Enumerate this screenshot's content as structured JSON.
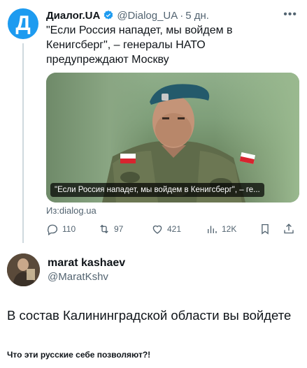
{
  "tweet1": {
    "avatar_letter": "Д",
    "author_name": "Диалог.UA",
    "handle": "@Dialog_UA",
    "separator": "·",
    "time": "5 дн.",
    "text": "\"Если Россия нападет, мы войдем в Кенигсберг\", – генералы НАТО предупреждают Москву",
    "card_caption": "\"Если Россия нападет, мы войдем в Кенигсберг\", – ге...",
    "from_label": "Из:dialog.ua",
    "actions": {
      "replies": "110",
      "reposts": "97",
      "likes": "421",
      "views": "12K"
    }
  },
  "tweet2": {
    "author_name": "marat kashaev",
    "handle": "@MaratKshv",
    "text": "В состав Калининградской области вы войдете"
  },
  "footer_caption": "Что эти русские себе позволяют?!",
  "colors": {
    "accent": "#1d9bf0",
    "text": "#0f1419",
    "muted": "#536471"
  }
}
